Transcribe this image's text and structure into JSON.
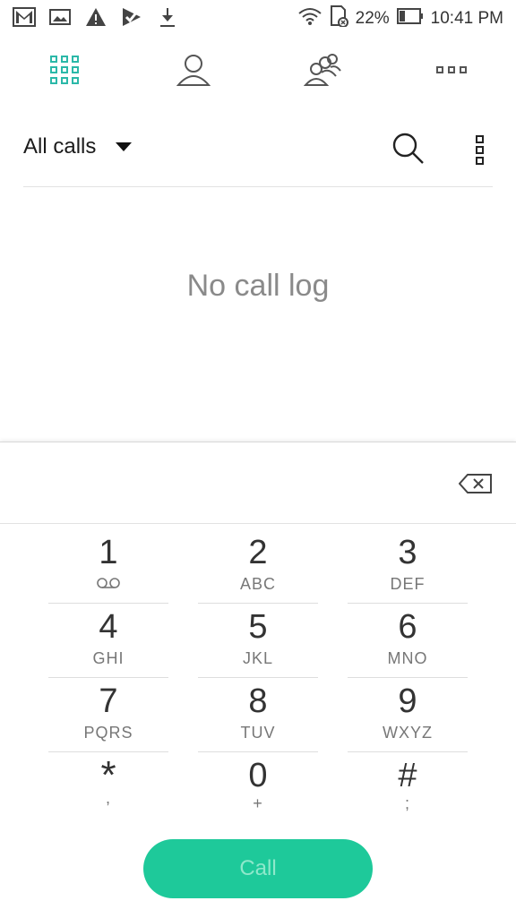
{
  "status_bar": {
    "battery_percent": "22%",
    "time": "10:41 PM",
    "left_icons": [
      "gmail-icon",
      "image-icon",
      "warning-icon",
      "checkmark-app-icon",
      "download-icon"
    ],
    "right_icons": [
      "wifi-icon",
      "sd-card-icon",
      "battery-icon"
    ]
  },
  "tabs": [
    {
      "icon": "dialpad-icon",
      "active": true
    },
    {
      "icon": "contact-icon",
      "active": false
    },
    {
      "icon": "groups-icon",
      "active": false
    },
    {
      "icon": "more-tabs-icon",
      "active": false
    }
  ],
  "filter": {
    "label": "All calls"
  },
  "empty_state": "No call log",
  "dialer": {
    "number_value": "",
    "keys": [
      {
        "digit": "1",
        "sub": ""
      },
      {
        "digit": "2",
        "sub": "ABC"
      },
      {
        "digit": "3",
        "sub": "DEF"
      },
      {
        "digit": "4",
        "sub": "GHI"
      },
      {
        "digit": "5",
        "sub": "JKL"
      },
      {
        "digit": "6",
        "sub": "MNO"
      },
      {
        "digit": "7",
        "sub": "PQRS"
      },
      {
        "digit": "8",
        "sub": "TUV"
      },
      {
        "digit": "9",
        "sub": "WXYZ"
      },
      {
        "digit": "*",
        "sub": ","
      },
      {
        "digit": "0",
        "sub": "+"
      },
      {
        "digit": "#",
        "sub": ";"
      }
    ],
    "call_label": "Call"
  },
  "colors": {
    "accent": "#2bb8a8",
    "call_button": "#1ec99a",
    "call_text": "#8ee8cb"
  }
}
